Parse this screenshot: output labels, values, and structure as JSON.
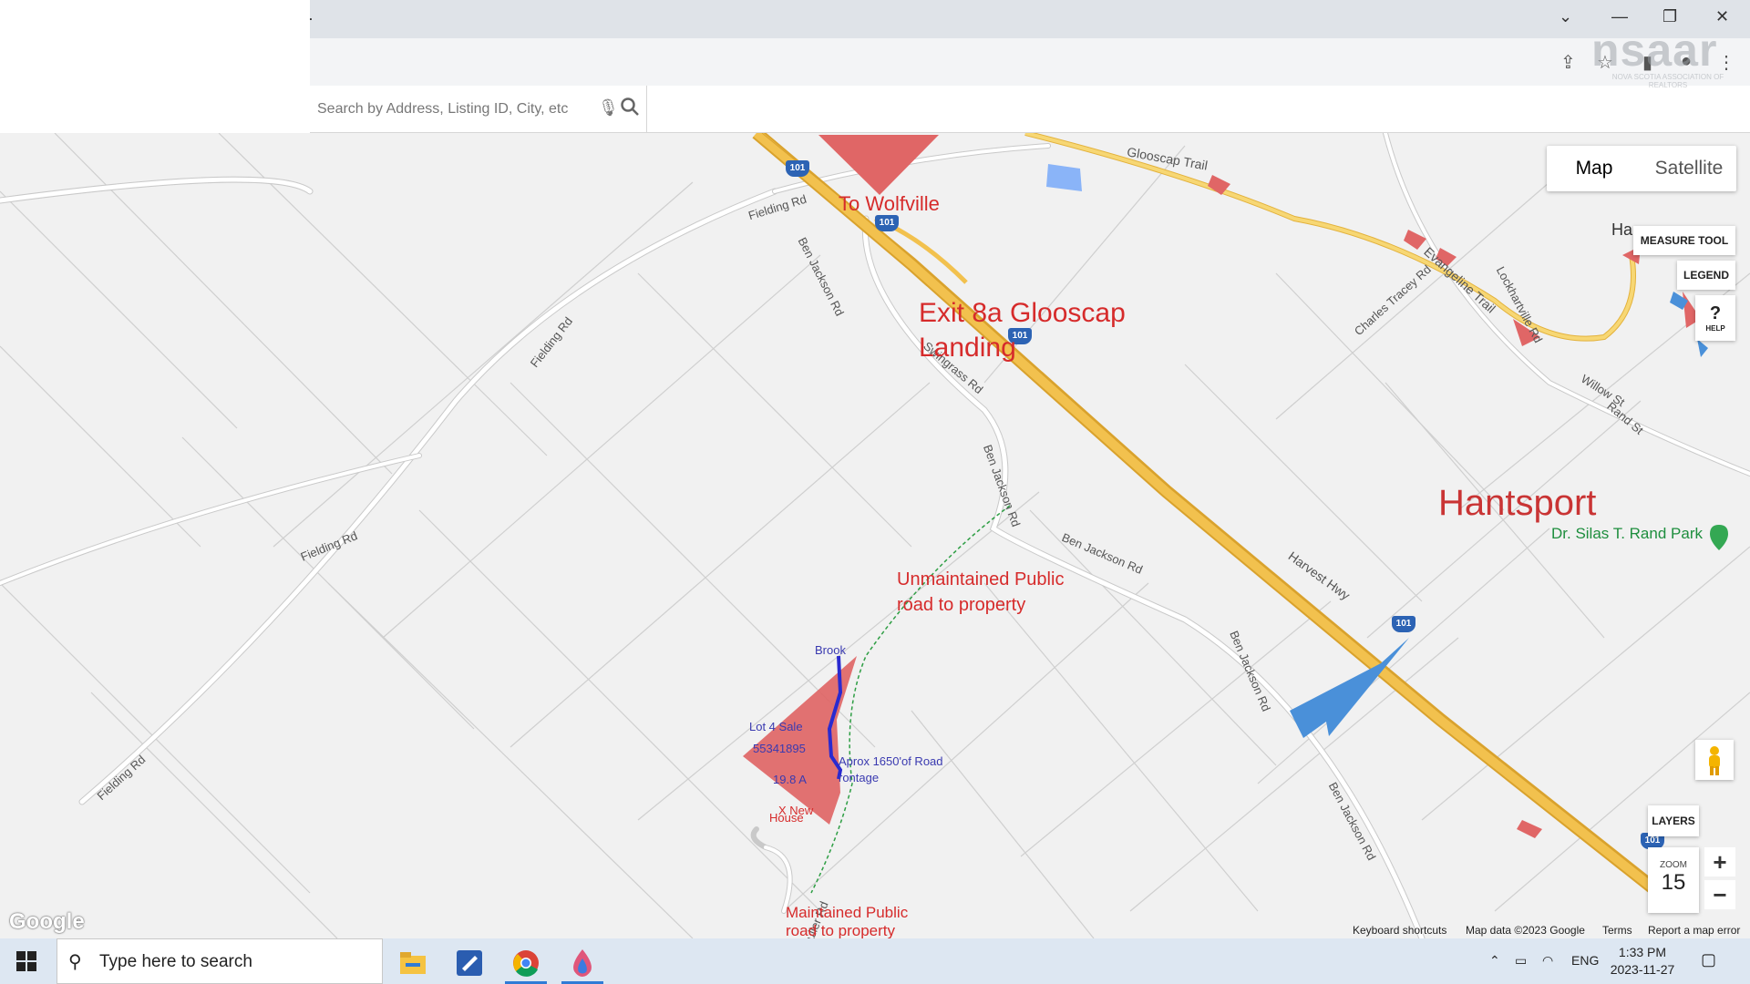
{
  "browser": {
    "new_tab_icon": "plus-icon",
    "window_controls": [
      "chevron-down-icon",
      "minimize-icon",
      "restore-icon",
      "close-icon"
    ],
    "toolbar_icons": [
      "share-icon",
      "star-icon",
      "sidepanel-icon",
      "profile-icon",
      "menu-icon"
    ]
  },
  "logo": {
    "text": "nsaar",
    "subtitle": "NOVA SCOTIA ASSOCIATION OF REALTORS"
  },
  "search": {
    "placeholder": "Search by Address, Listing ID, City, etc",
    "mic_icon": "mic-off-icon",
    "search_icon": "search-icon"
  },
  "map": {
    "type_buttons": {
      "map": "Map",
      "satellite": "Satellite"
    },
    "measure_tool": "MEASURE TOOL",
    "legend": "LEGEND",
    "help": "HELP",
    "layers": "LAYERS",
    "zoom_label": "ZOOM",
    "zoom_value": "15",
    "zoom_in": "+",
    "zoom_out": "−",
    "roads": {
      "fielding1": "Fielding Rd",
      "fielding2": "Fielding Rd",
      "fielding3": "Fielding Rd",
      "fielding4": "Fielding Rd",
      "ben1": "Ben Jackson Rd",
      "ben2": "Ben Jackson Rd",
      "ben3": "Ben Jackson Rd",
      "ben4": "Ben Jackson Rd",
      "ben5": "Ben Jackson Rd",
      "swingrass": "Swingrass Rd",
      "glooscap": "Glooscap Trail",
      "charles": "Charles Tracey Rd",
      "evangeline": "Evangeline Trail",
      "lockhartville": "Lockhartville Rd",
      "willow": "Willow St",
      "rand": "Rand St",
      "harvest": "Harvest Hwy",
      "fuller": "Fuller Rd",
      "hants_partial": "Ha",
      "park": "Dr. Silas T. Rand Park"
    },
    "shields": [
      "101",
      "101",
      "101",
      "101",
      "101"
    ],
    "annotations": {
      "wolfville": "To Wolfville",
      "exit_line1": "Exit 8a Glooscap",
      "exit_line2": "Landing",
      "hantsport": "Hantsport",
      "unmaintained_line1": "Unmaintained Public",
      "unmaintained_line2": "road to property",
      "maintained_line1": "Maintained Public",
      "maintained_line2": "road to property",
      "brook": "Brook",
      "lot": "Lot 4 Sale",
      "pid": "55341895",
      "acres": "19.8 A",
      "frontage_line1": "Aprox 1650'of Road",
      "frontage_line2": "rontage",
      "new_house_x": "X New",
      "new_house": "House"
    },
    "attribution": {
      "google": "Google",
      "shortcuts": "Keyboard shortcuts",
      "mapdata": "Map data ©2023 Google",
      "terms": "Terms",
      "report": "Report a map error"
    },
    "colors": {
      "parcel_red": "#e06666",
      "parcel_blue": "#4a90d9",
      "highway": "#f2c14e",
      "annotation_red": "#d62b2b",
      "annotation_blue": "#3a3ab0"
    }
  },
  "taskbar": {
    "search_placeholder": "Type here to search",
    "apps": [
      "file-explorer-icon",
      "pdf-editor-icon",
      "chrome-icon",
      "paint-icon"
    ],
    "tray": {
      "lang": "ENG",
      "time": "1:33 PM",
      "date": "2023-11-27"
    }
  }
}
